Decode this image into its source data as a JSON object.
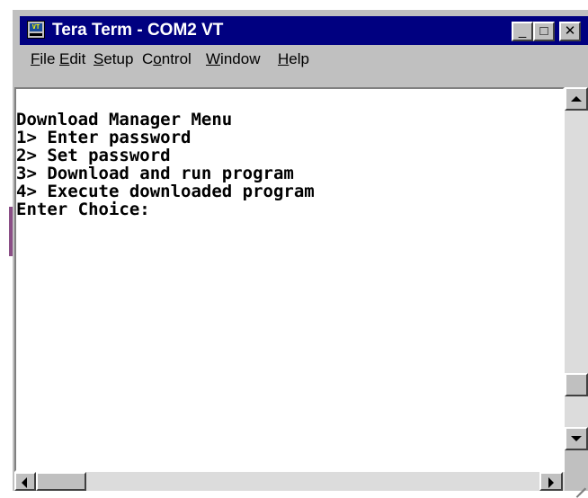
{
  "window": {
    "title": "Tera Term - COM2 VT",
    "icon_text": "VT",
    "controls": {
      "minimize": "_",
      "maximize": "□",
      "close": "✕"
    }
  },
  "menu": {
    "items": [
      {
        "label": "File",
        "accel": "F"
      },
      {
        "label": "Edit",
        "accel": "E"
      },
      {
        "label": "Setup",
        "accel": "S"
      },
      {
        "label": "Control",
        "accel": "o"
      },
      {
        "label": "Window",
        "accel": "W"
      },
      {
        "label": "Help",
        "accel": "H"
      }
    ]
  },
  "terminal": {
    "lines": [
      "Download Manager Menu",
      "1> Enter password",
      "2> Set password",
      "3> Download and run program",
      "4> Execute downloaded program",
      "Enter Choice:"
    ]
  },
  "colors": {
    "titlebar": "#000080",
    "chrome": "#c0c0c0",
    "terminal_bg": "#ffffff",
    "terminal_fg": "#000000"
  },
  "icons": [
    "tera-term-app-icon",
    "scroll-up-icon",
    "scroll-down-icon",
    "scroll-left-icon",
    "scroll-right-icon",
    "resize-grip-icon"
  ]
}
